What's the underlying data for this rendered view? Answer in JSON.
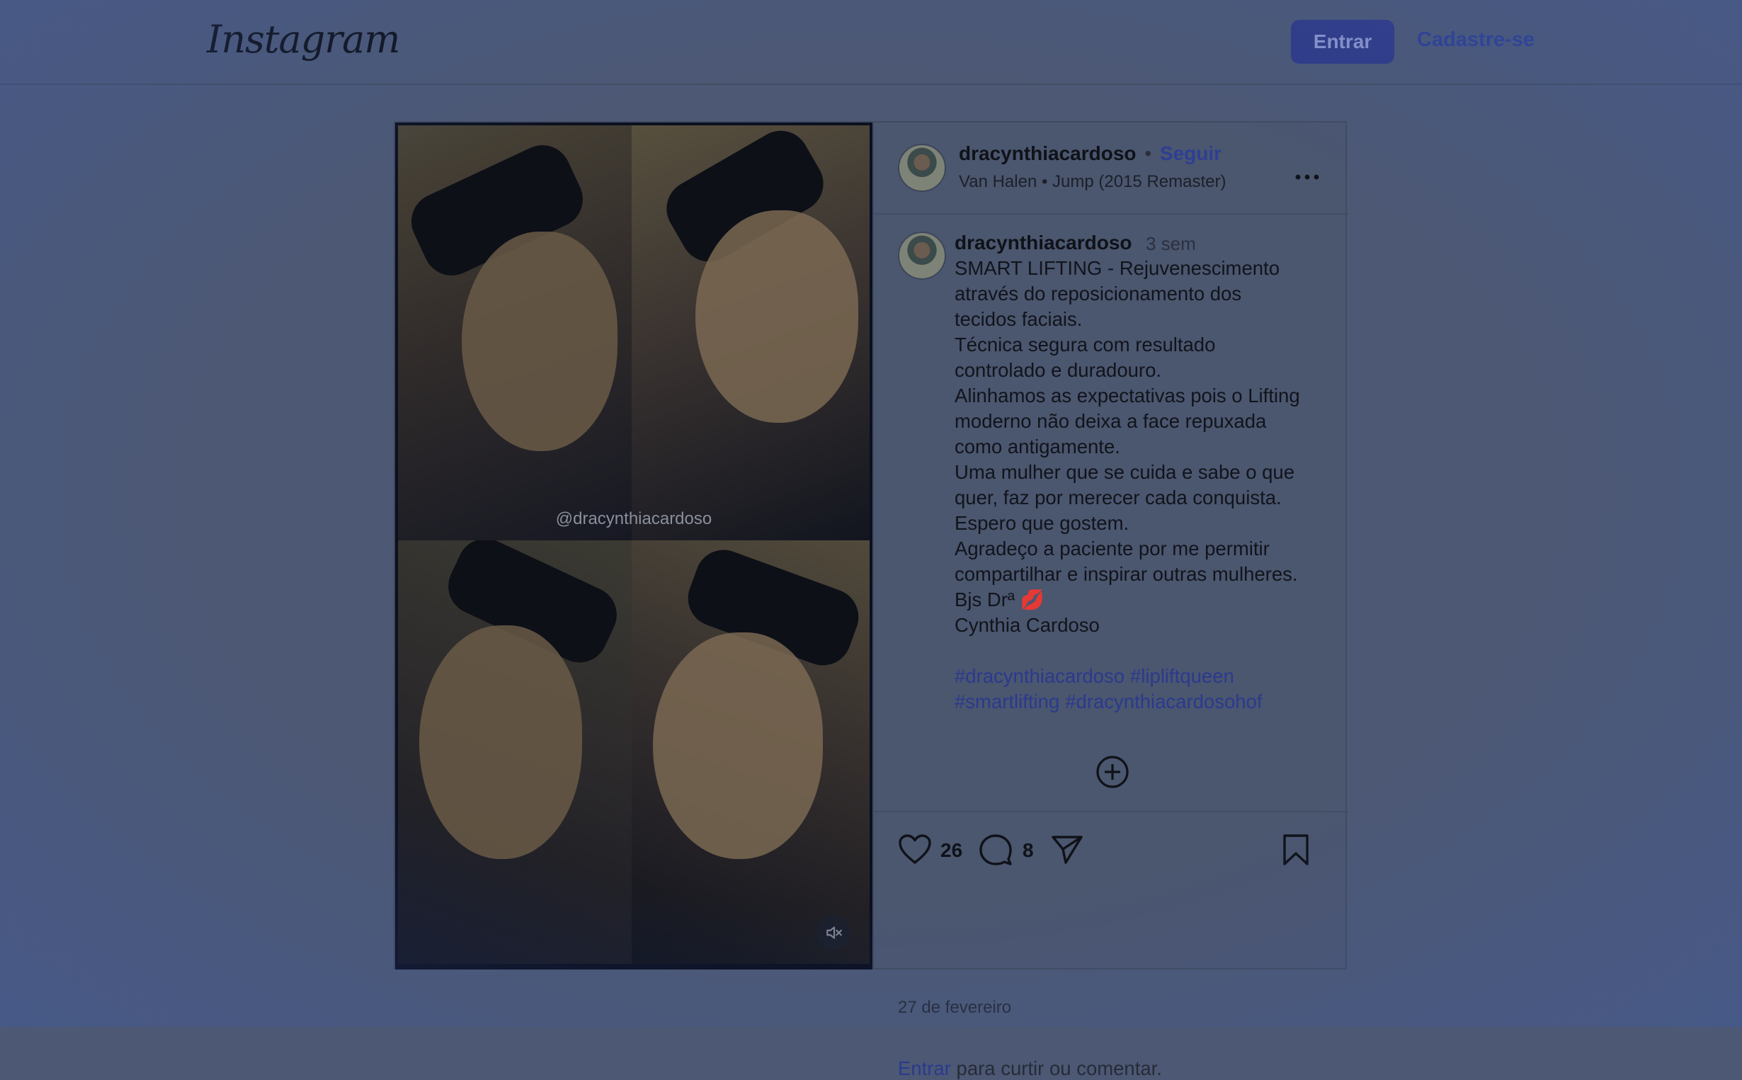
{
  "header": {
    "logo": "Instagram",
    "login_label": "Entrar",
    "signup_label": "Cadastre-se"
  },
  "media": {
    "watermark": "@dracynthiacardoso",
    "mute_icon": "speaker-muted-icon"
  },
  "post": {
    "username": "dracynthiacardoso",
    "separator": "•",
    "follow_label": "Seguir",
    "music": "Van Halen • Jump (2015 Remaster)",
    "more_icon": "more-options-icon",
    "caption": {
      "username": "dracynthiacardoso",
      "time": "3 sem",
      "text": "SMART LIFTING - Rejuvenescimento\natravés do reposicionamento dos\ntecidos faciais.\nTécnica segura com resultado\ncontrolado e duradouro.\nAlinhamos as expectativas pois o Lifting\nmoderno não deixa a face repuxada\ncomo antigamente.\nUma mulher que se cuida e sabe o que\nquer, faz por merecer cada conquista.\nEspero que gostem.\nAgradeço a paciente por me permitir\ncompartilhar e inspirar outras mulheres.\nBjs Drª 💋\nCynthia Cardoso",
      "hashtags": [
        "#dracynthiacardoso",
        "#lipliftqueen",
        "#smartlifting",
        "#dracynthiacardosohof"
      ]
    },
    "load_more_icon": "plus-circle-icon",
    "likes": "26",
    "comments": "8",
    "date": "27 de fevereiro",
    "footer": {
      "login_link": "Entrar",
      "text": " para curtir ou comentar."
    }
  },
  "colors": {
    "overlay_background": "#4c5874",
    "link": "#2e3f93",
    "button": "#2f3a86"
  }
}
